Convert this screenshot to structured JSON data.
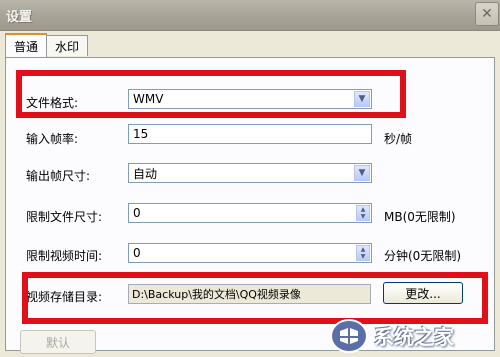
{
  "window": {
    "title": "设置",
    "close_symbol": "✕"
  },
  "tabs": [
    {
      "label": "普通",
      "selected": true
    },
    {
      "label": "水印",
      "selected": false
    }
  ],
  "settings": {
    "file_format": {
      "label": "文件格式:",
      "value": "WMV"
    },
    "frame_rate": {
      "label": "输入帧率:",
      "value": "15",
      "unit": "秒/帧"
    },
    "frame_size": {
      "label": "输出帧尺寸:",
      "value": "自动"
    },
    "file_size_limit": {
      "label": "限制文件尺寸:",
      "value": "0",
      "unit": "MB(0无限制)"
    },
    "duration_limit": {
      "label": "限制视频时间:",
      "value": "0",
      "unit": "分钟(0无限制)"
    },
    "save_dir": {
      "label": "视频存储目录:",
      "value": "D:\\Backup\\我的文档\\QQ视频录像",
      "button": "更改..."
    }
  },
  "footer": {
    "default_button": "默认"
  },
  "watermark": {
    "text": "系统之家",
    "icon": "logo-emblem"
  },
  "colors": {
    "highlight": "#e0101a",
    "titlebar": "#a8a397",
    "dialog_bg": "#ece9d8"
  }
}
